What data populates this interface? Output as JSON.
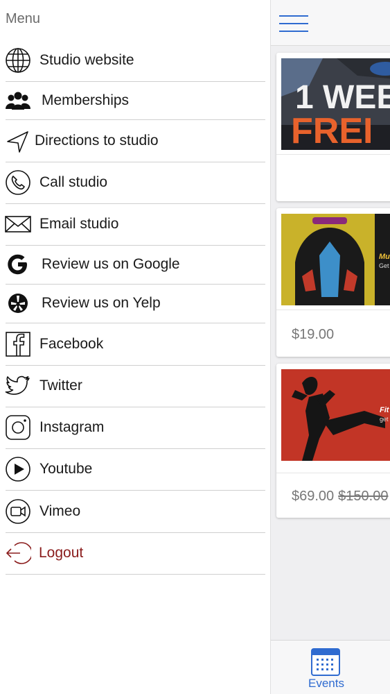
{
  "menu": {
    "title": "Menu",
    "items": [
      {
        "label": "Studio website",
        "icon": "globe-icon"
      },
      {
        "label": "Memberships",
        "icon": "people-icon"
      },
      {
        "label": "Directions to studio",
        "icon": "navigation-arrow-icon"
      },
      {
        "label": "Call studio",
        "icon": "phone-icon"
      },
      {
        "label": "Email studio",
        "icon": "envelope-icon"
      },
      {
        "label": "Review us on Google",
        "icon": "google-icon"
      },
      {
        "label": "Review us on Yelp",
        "icon": "yelp-icon"
      },
      {
        "label": "Facebook",
        "icon": "facebook-icon"
      },
      {
        "label": "Twitter",
        "icon": "twitter-icon"
      },
      {
        "label": "Instagram",
        "icon": "instagram-icon"
      },
      {
        "label": "Youtube",
        "icon": "youtube-icon"
      },
      {
        "label": "Vimeo",
        "icon": "vimeo-icon"
      },
      {
        "label": "Logout",
        "icon": "logout-icon"
      }
    ]
  },
  "cards": [
    {
      "image_text_line1": "1 WEE",
      "image_text_line2": "FREI",
      "price": "",
      "old_price": ""
    },
    {
      "image_text": "Mu",
      "image_subtext": "Get",
      "price": "$19.00",
      "old_price": ""
    },
    {
      "image_text": "Fit",
      "image_subtext": "get",
      "price": "$69.00",
      "old_price": "$150.00"
    }
  ],
  "tabbar": {
    "events_label": "Events"
  },
  "colors": {
    "accent": "#2f6bd0",
    "logout": "#8a1c1c",
    "card_bg": "#ffffff",
    "content_bg": "#efeff1"
  }
}
